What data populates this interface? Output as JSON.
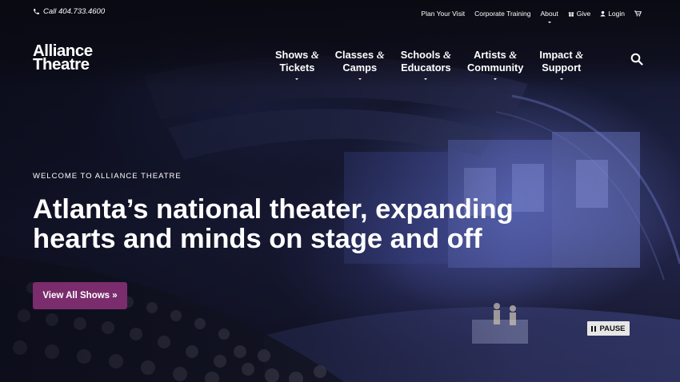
{
  "utility": {
    "phone": "Call 404.733.4600",
    "links": [
      "Plan Your Visit",
      "Corporate Training",
      "About",
      "Give",
      "Login"
    ]
  },
  "logo": {
    "line1": "Alliance",
    "line2": "Theatre"
  },
  "nav": [
    {
      "line1": "Shows",
      "line2": "Tickets"
    },
    {
      "line1": "Classes",
      "line2": "Camps"
    },
    {
      "line1": "Schools",
      "line2": "Educators"
    },
    {
      "line1": "Artists",
      "line2": "Community"
    },
    {
      "line1": "Impact",
      "line2": "Support"
    }
  ],
  "nav_amp": "&",
  "hero": {
    "eyebrow": "WELCOME TO ALLIANCE THEATRE",
    "headline_line1": "Atlanta’s national theater, expanding",
    "headline_line2": "hearts and minds on stage and off",
    "cta": "View All Shows »",
    "pause": "PAUSE"
  },
  "colors": {
    "cta": "#7a2c6c",
    "pause_bg": "#e6e6e6"
  },
  "icons": [
    "phone-icon",
    "gift-icon",
    "user-icon",
    "cart-icon",
    "search-icon",
    "pause-icon"
  ]
}
